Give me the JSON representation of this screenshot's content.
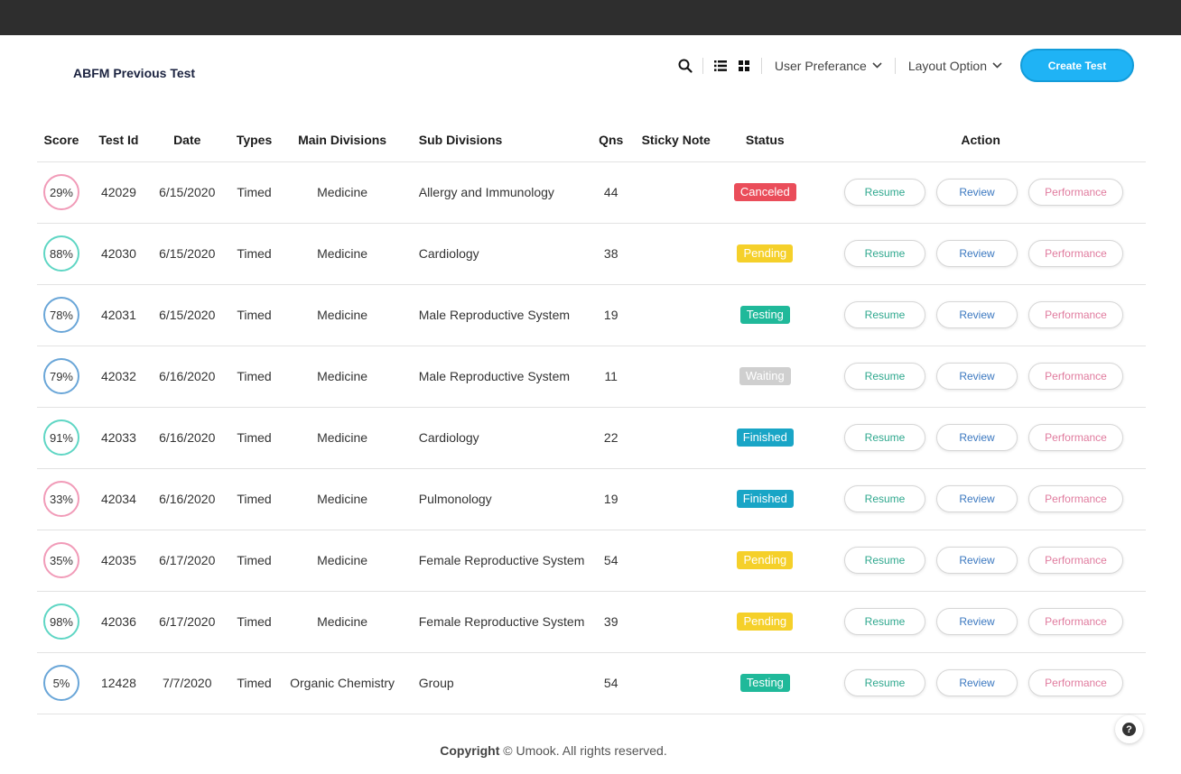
{
  "header": {
    "title": "ABFM Previous Test",
    "user_preference_label": "User Preferance",
    "layout_option_label": "Layout Option",
    "create_test_label": "Create Test",
    "icons": [
      "search-icon",
      "list-view-icon",
      "grid-view-icon",
      "chevron-down-icon"
    ]
  },
  "table": {
    "columns": [
      "Score",
      "Test Id",
      "Date",
      "Types",
      "Main Divisions",
      "Sub Divisions",
      "Qns",
      "Sticky Note",
      "Status",
      "Action"
    ],
    "action_labels": {
      "resume": "Resume",
      "review": "Review",
      "performance": "Performance"
    },
    "rows": [
      {
        "score": "29%",
        "score_color": "pink",
        "test_id": "42029",
        "date": "6/15/2020",
        "type": "Timed",
        "main_division": "Medicine",
        "sub_division": "Allergy and Immunology",
        "qns": "44",
        "sticky_note": "",
        "status": "Canceled",
        "status_kind": "canceled"
      },
      {
        "score": "88%",
        "score_color": "teal",
        "test_id": "42030",
        "date": "6/15/2020",
        "type": "Timed",
        "main_division": "Medicine",
        "sub_division": "Cardiology",
        "qns": "38",
        "sticky_note": "",
        "status": "Pending",
        "status_kind": "pending"
      },
      {
        "score": "78%",
        "score_color": "blue",
        "test_id": "42031",
        "date": "6/15/2020",
        "type": "Timed",
        "main_division": "Medicine",
        "sub_division": "Male Reproductive System",
        "qns": "19",
        "sticky_note": "",
        "status": "Testing",
        "status_kind": "testing"
      },
      {
        "score": "79%",
        "score_color": "blue",
        "test_id": "42032",
        "date": "6/16/2020",
        "type": "Timed",
        "main_division": "Medicine",
        "sub_division": "Male Reproductive System",
        "qns": "11",
        "sticky_note": "",
        "status": "Waiting",
        "status_kind": "waiting"
      },
      {
        "score": "91%",
        "score_color": "teal",
        "test_id": "42033",
        "date": "6/16/2020",
        "type": "Timed",
        "main_division": "Medicine",
        "sub_division": "Cardiology",
        "qns": "22",
        "sticky_note": "",
        "status": "Finished",
        "status_kind": "finished"
      },
      {
        "score": "33%",
        "score_color": "pink",
        "test_id": "42034",
        "date": "6/16/2020",
        "type": "Timed",
        "main_division": "Medicine",
        "sub_division": "Pulmonology",
        "qns": "19",
        "sticky_note": "",
        "status": "Finished",
        "status_kind": "finished"
      },
      {
        "score": "35%",
        "score_color": "pink",
        "test_id": "42035",
        "date": "6/17/2020",
        "type": "Timed",
        "main_division": "Medicine",
        "sub_division": "Female Reproductive System",
        "qns": "54",
        "sticky_note": "",
        "status": "Pending",
        "status_kind": "pending"
      },
      {
        "score": "98%",
        "score_color": "teal",
        "test_id": "42036",
        "date": "6/17/2020",
        "type": "Timed",
        "main_division": "Medicine",
        "sub_division": "Female Reproductive System",
        "qns": "39",
        "sticky_note": "",
        "status": "Pending",
        "status_kind": "pending"
      },
      {
        "score": "5%",
        "score_color": "blue",
        "test_id": "12428",
        "date": "7/7/2020",
        "type": "Timed",
        "main_division": "Organic Chemistry",
        "sub_division": "Group",
        "qns": "54",
        "sticky_note": "",
        "status": "Testing",
        "status_kind": "testing"
      }
    ]
  },
  "footer": {
    "copyright_label": "Copyright",
    "copyright_text": "© Umook. All rights reserved.",
    "help_icon": "help-icon",
    "help_glyph": "?"
  },
  "colors": {
    "topbar": "#2e2e2e",
    "accent": "#1fb3f5",
    "canceled": "#ea4d5a",
    "pending": "#f5d02a",
    "testing": "#20b99a",
    "waiting": "#cfcfcf",
    "finished": "#19a5c6"
  }
}
